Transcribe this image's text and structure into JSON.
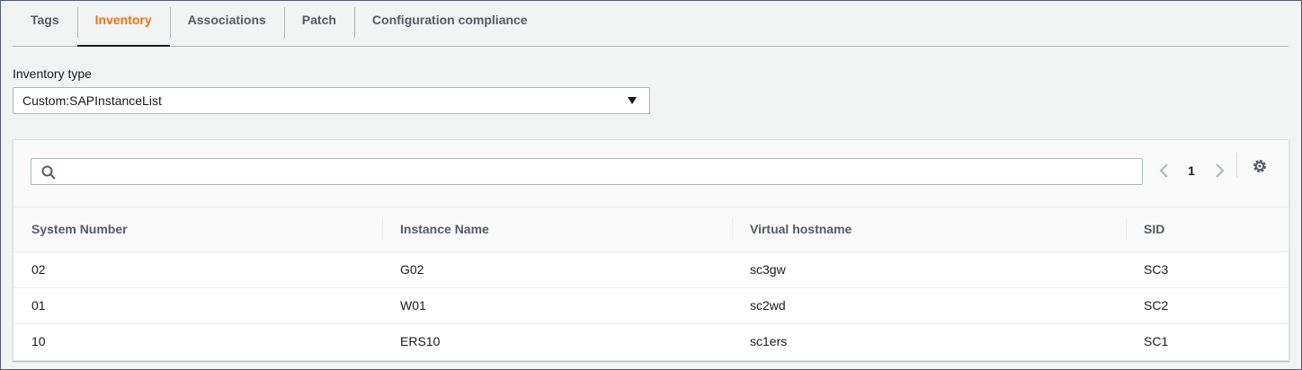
{
  "tabs": [
    {
      "label": "Tags",
      "active": false
    },
    {
      "label": "Inventory",
      "active": true
    },
    {
      "label": "Associations",
      "active": false
    },
    {
      "label": "Patch",
      "active": false
    },
    {
      "label": "Configuration compliance",
      "active": false
    }
  ],
  "inventory_type": {
    "label": "Inventory type",
    "selected": "Custom:SAPInstanceList"
  },
  "search": {
    "value": ""
  },
  "pagination": {
    "current_page": "1"
  },
  "table": {
    "columns": [
      "System Number",
      "Instance Name",
      "Virtual hostname",
      "SID"
    ],
    "rows": [
      [
        "02",
        "G02",
        "sc3gw",
        "SC3"
      ],
      [
        "01",
        "W01",
        "sc2wd",
        "SC2"
      ],
      [
        "10",
        "ERS10",
        "sc1ers",
        "SC1"
      ]
    ]
  },
  "colors": {
    "active_tab": "#ec7211",
    "text": "#16191f",
    "muted": "#545b64"
  },
  "icons": [
    "search-icon",
    "chevron-left-icon",
    "chevron-right-icon",
    "gear-icon",
    "caret-down-icon"
  ]
}
